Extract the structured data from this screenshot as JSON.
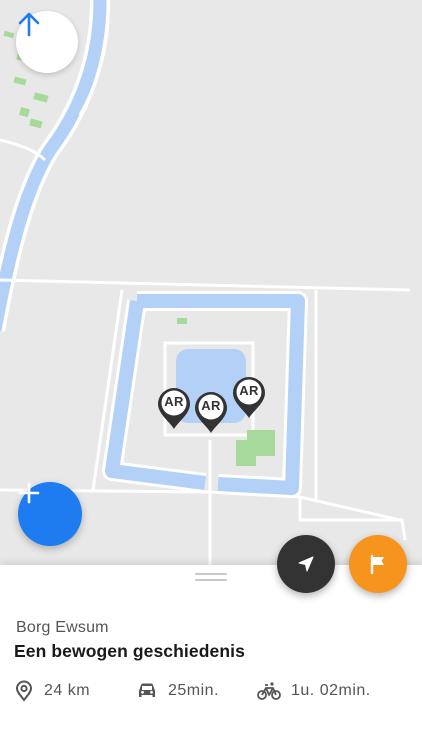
{
  "map": {
    "colors": {
      "land": "#e8e8e8",
      "water": "#b3d1f7",
      "green": "#a6d99a",
      "road": "#ffffff"
    },
    "markers": [
      {
        "label": "AR"
      },
      {
        "label": "AR"
      },
      {
        "label": "AR"
      }
    ],
    "controls": {
      "compass_icon": "arrow-up-icon",
      "add_icon": "plus-icon",
      "locate_icon": "navigation-arrow-icon",
      "flag_icon": "flag-icon"
    }
  },
  "sheet": {
    "place_name": "Borg Ewsum",
    "route_title": "Een bewogen geschiedenis",
    "stats": {
      "distance": "24 km",
      "car_time": "25min.",
      "bike_time": "1u. 02min."
    }
  },
  "colors": {
    "accent_blue": "#1e7cf0",
    "accent_orange": "#f7941d",
    "dark": "#333333"
  }
}
